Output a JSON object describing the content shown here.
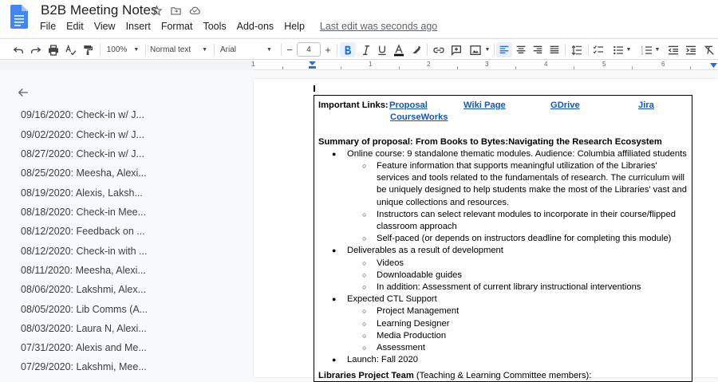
{
  "doc": {
    "title": "B2B Meeting Notes",
    "menu": [
      "File",
      "Edit",
      "View",
      "Insert",
      "Format",
      "Tools",
      "Add-ons",
      "Help"
    ],
    "last_edit": "Last edit was seconds ago"
  },
  "toolbar": {
    "zoom": "100%",
    "style": "Normal text",
    "font": "Arial",
    "font_size": "4",
    "minus": "−",
    "plus": "+"
  },
  "ruler": {
    "numbers": [
      "1",
      "1",
      "2",
      "3",
      "4",
      "5",
      "6"
    ]
  },
  "outline": {
    "items": [
      "09/16/2020: Check-in w/ J...",
      "09/02/2020: Check-in w/ J...",
      "08/27/2020: Check-in w/ J...",
      "08/25/2020: Meesha, Alexi...",
      "08/19/2020: Alexis, Laksh...",
      "08/18/2020: Check-in Mee...",
      "08/12/2020: Feedback on ...",
      "08/12/2020: Check-in with ...",
      "08/11/2020: Meesha, Alexi...",
      "08/06/2020: Lakshmi, Alex...",
      "08/05/2020: Lib Comms (A...",
      "08/03/2020: Laura N, Alexi...",
      "07/31/2020: Alexis and Me...",
      "07/29/2020: Lakshmi, Mee..."
    ]
  },
  "content": {
    "links_label": "Important Links:",
    "links": [
      "Proposal",
      "Wiki Page",
      "GDrive",
      "Jira",
      "CourseWorks"
    ],
    "summary": "Summary of proposal: From Books to Bytes:Navigating the Research Ecosystem",
    "lines": [
      "Online course: 9 standalone thematic modules. Audience: Columbia affiliated students",
      "Feature information that supports meaningful utilization of the Libraries'",
      "services and tools related to the fundamentals of research. The curriculum will",
      "be uniquely designed to help students make the most of the Libraries' vast and",
      "unique collections and resources.",
      "Instructors can select relevant modules to incorporate in their course/flipped",
      "classroom approach",
      "Self-paced (or depends on instructors deadline for completing this module)",
      "Deliverables as a result of development",
      "Videos",
      "Downloadable guides",
      "In addition: Assessment of current library instructional interventions",
      "Expected CTL Support",
      "Project Management",
      "Learning Designer",
      "Media Production",
      "Assessment",
      "Launch: Fall 2020"
    ],
    "team_label": "Libraries Project Team",
    "team_suffix": " (Teaching & Learning Committee members):"
  }
}
